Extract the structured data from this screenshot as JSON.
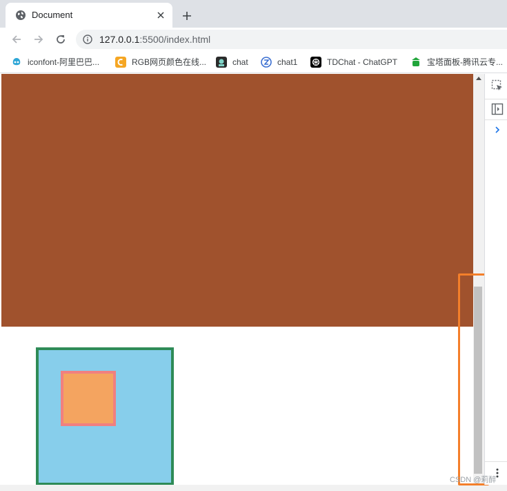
{
  "tab": {
    "title": "Document",
    "favicon": "globe-icon"
  },
  "toolbar": {
    "back": "back-arrow-icon",
    "forward": "forward-arrow-icon",
    "reload": "reload-icon",
    "url_host": "127.0.0.1",
    "url_rest": ":5500/index.html"
  },
  "bookmarks": [
    {
      "label": "iconfont-阿里巴巴...",
      "icon": "iconfont-icon",
      "color": "#2ea6d6"
    },
    {
      "label": "RGB网页颜色在线...",
      "icon": "rgb-icon",
      "color": "#f5a623"
    },
    {
      "label": "chat",
      "icon": "chat-icon",
      "color": "#1a1a1a"
    },
    {
      "label": "chat1",
      "icon": "chat1-icon",
      "color": "#3b6fd1"
    },
    {
      "label": "TDChat - ChatGPT",
      "icon": "openai-icon",
      "color": "#000000"
    },
    {
      "label": "宝塔面板-腾讯云专...",
      "icon": "baota-icon",
      "color": "#20a53a"
    }
  ],
  "page": {
    "brown_color": "#a0522d",
    "outer_box": {
      "fill": "#87ceeb",
      "border": "#2e8b57"
    },
    "inner_box": {
      "fill": "#f4a460",
      "border": "#f08080"
    }
  },
  "watermark": "CSDN @莉醉"
}
